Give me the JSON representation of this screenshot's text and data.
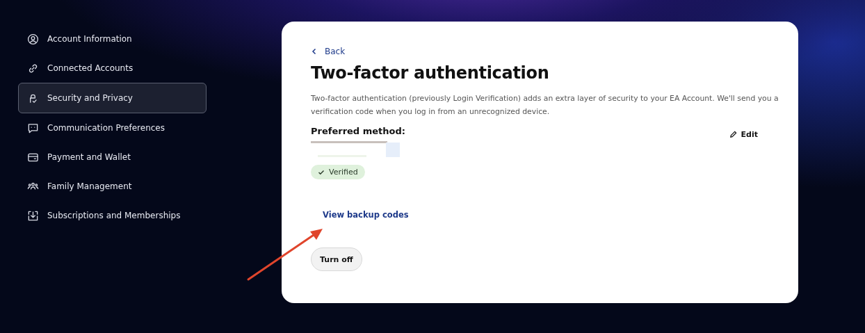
{
  "sidebar": {
    "items": [
      {
        "label": "Account Information",
        "selected": false
      },
      {
        "label": "Connected Accounts",
        "selected": false
      },
      {
        "label": "Security and Privacy",
        "selected": true
      },
      {
        "label": "Communication Preferences",
        "selected": false
      },
      {
        "label": "Payment and Wallet",
        "selected": false
      },
      {
        "label": "Family Management",
        "selected": false
      },
      {
        "label": "Subscriptions and Memberships",
        "selected": false
      }
    ]
  },
  "card": {
    "back": "Back",
    "title": "Two-factor authentication",
    "description": "Two-factor authentication (previously Login Verification) adds an extra layer of security to your EA Account. We'll send you a verification code when you log in from an unrecognized device.",
    "method_label": "Preferred method:",
    "edit": "Edit",
    "status": "Verified",
    "link": "View backup codes",
    "button": "Turn off"
  }
}
